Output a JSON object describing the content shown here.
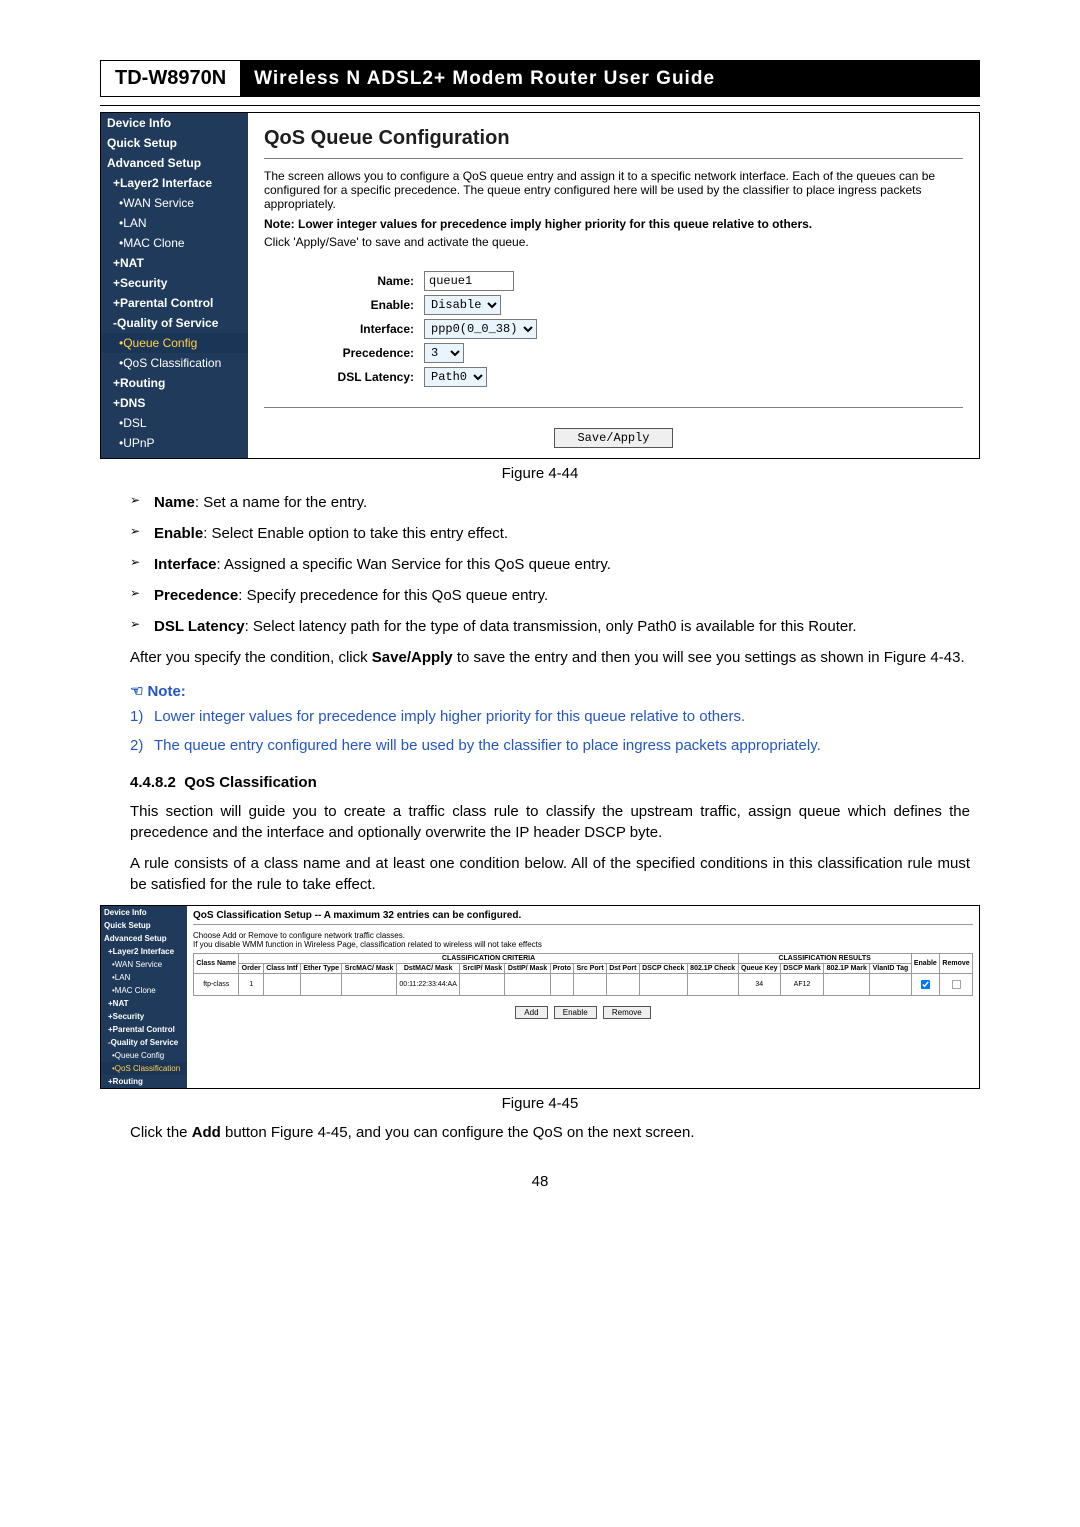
{
  "header": {
    "model": "TD-W8970N",
    "title": "Wireless  N  ADSL2+  Modem  Router  User  Guide"
  },
  "shot1": {
    "sidebar": [
      {
        "cls": "top",
        "label": "Device Info"
      },
      {
        "cls": "top",
        "label": "Quick Setup"
      },
      {
        "cls": "top",
        "label": "Advanced Setup"
      },
      {
        "cls": "sub1",
        "label": "+Layer2 Interface"
      },
      {
        "cls": "sub2",
        "label": "•WAN Service"
      },
      {
        "cls": "sub2",
        "label": "•LAN"
      },
      {
        "cls": "sub2",
        "label": "•MAC Clone"
      },
      {
        "cls": "sub1",
        "label": "+NAT"
      },
      {
        "cls": "sub1",
        "label": "+Security"
      },
      {
        "cls": "sub1",
        "label": "+Parental Control"
      },
      {
        "cls": "open",
        "label": "-Quality of Service"
      },
      {
        "cls": "sub2 active",
        "label": "•Queue Config"
      },
      {
        "cls": "sub2",
        "label": "•QoS Classification"
      },
      {
        "cls": "sub1",
        "label": "+Routing"
      },
      {
        "cls": "sub1",
        "label": "+DNS"
      },
      {
        "cls": "sub2",
        "label": "•DSL"
      },
      {
        "cls": "sub2",
        "label": "•UPnP"
      }
    ],
    "title": "QoS Queue Configuration",
    "intro": "The screen allows you to configure a QoS queue entry and assign it to a specific network interface. Each of the queues can be configured for a specific precedence. The queue entry configured here will be used by the classifier to place ingress packets appropriately.",
    "note_bold": "Note: Lower integer values for precedence imply higher priority for this queue relative to others.",
    "apply_hint": "Click 'Apply/Save' to save and activate the queue.",
    "form": {
      "name_lbl": "Name:",
      "name_val": "queue1",
      "enable_lbl": "Enable:",
      "enable_val": "Disable",
      "iface_lbl": "Interface:",
      "iface_val": "ppp0(0_0_38)",
      "prec_lbl": "Precedence:",
      "prec_val": "3",
      "lat_lbl": "DSL Latency:",
      "lat_val": "Path0"
    },
    "save_btn": "Save/Apply"
  },
  "caption1": "Figure 4-44",
  "defs": [
    {
      "term": "Name",
      "text": ": Set a name for the entry."
    },
    {
      "term": "Enable",
      "text": ": Select Enable option to take this entry effect."
    },
    {
      "term": "Interface",
      "text": ": Assigned a specific Wan Service for this QoS queue entry."
    },
    {
      "term": "Precedence",
      "text": ": Specify precedence for this QoS queue entry."
    },
    {
      "term": "DSL Latency",
      "text": ": Select latency path for the type of data transmission, only Path0 is available for this Router."
    }
  ],
  "after_text1": "After you specify the condition, click ",
  "after_bold": "Save/Apply",
  "after_text2": " to save the entry and then you will see you settings as shown in Figure 4-43.",
  "note_title": "Note:",
  "notes": [
    "Lower integer values for precedence imply higher priority for this queue relative to others.",
    "The queue entry configured here will be used by the classifier to place ingress packets appropriately."
  ],
  "sec_num": "4.4.8.2",
  "sec_title": "QoS Classification",
  "sec_p1": "This section will guide you to create a traffic class rule to classify the upstream traffic, assign queue which defines the precedence and the interface and optionally overwrite the IP header DSCP byte.",
  "sec_p2": "A rule consists of a class name and at least one condition below. All of the specified conditions in this classification rule must be satisfied for the rule to take effect.",
  "shot2": {
    "sidebar": [
      {
        "cls": "top",
        "label": "Device Info"
      },
      {
        "cls": "top",
        "label": "Quick Setup"
      },
      {
        "cls": "top",
        "label": "Advanced Setup"
      },
      {
        "cls": "sub1",
        "label": "+Layer2 Interface"
      },
      {
        "cls": "sub2",
        "label": "•WAN Service"
      },
      {
        "cls": "sub2",
        "label": "•LAN"
      },
      {
        "cls": "sub2",
        "label": "•MAC Clone"
      },
      {
        "cls": "sub1",
        "label": "+NAT"
      },
      {
        "cls": "sub1",
        "label": "+Security"
      },
      {
        "cls": "sub1",
        "label": "+Parental Control"
      },
      {
        "cls": "sub1",
        "label": "-Quality of Service"
      },
      {
        "cls": "sub2",
        "label": "•Queue Config"
      },
      {
        "cls": "sub2 active",
        "label": "•QoS Classification"
      },
      {
        "cls": "sub1",
        "label": "+Routing"
      }
    ],
    "title": "QoS Classification Setup -- A maximum 32 entries can be configured.",
    "desc": "Choose Add or Remove to configure network traffic classes.\nIf you disable WMM function in Wireless Page, classification related to wireless will not take effects",
    "grp_crit": "CLASSIFICATION CRITERIA",
    "grp_res": "CLASSIFICATION RESULTS",
    "headers": [
      "Class Name",
      "Order",
      "Class Intf",
      "Ether Type",
      "SrcMAC/ Mask",
      "DstMAC/ Mask",
      "SrcIP/ Mask",
      "DstIP/ Mask",
      "Proto",
      "Src Port",
      "Dst Port",
      "DSCP Check",
      "802.1P Check",
      "Queue Key",
      "DSCP Mark",
      "802.1P Mark",
      "VlanID Tag",
      "Enable",
      "Remove"
    ],
    "row": {
      "name": "ftp-class",
      "order": "1",
      "dstmac": "00:11:22:33:44:AA",
      "qkey": "34",
      "dscp": "AF12"
    },
    "b_add": "Add",
    "b_enable": "Enable",
    "b_remove": "Remove"
  },
  "caption2": "Figure 4-45",
  "foot1": "Click the ",
  "foot_b": "Add",
  "foot2": " button Figure 4-45, and you can configure the QoS on the next screen.",
  "page_num": "48"
}
